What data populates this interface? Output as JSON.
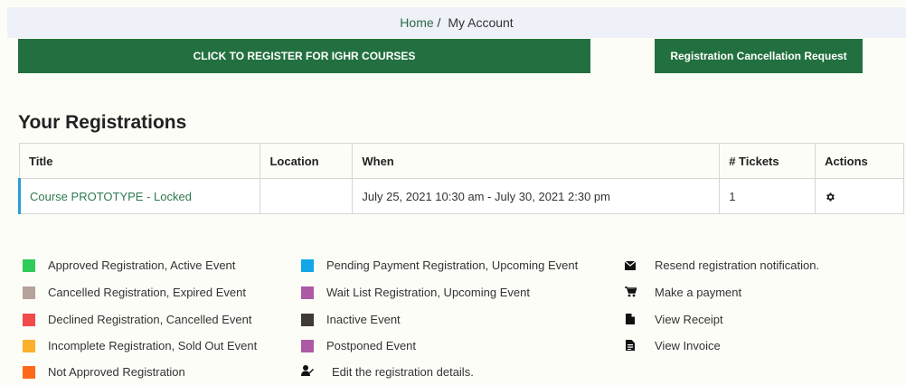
{
  "breadcrumb": {
    "home": "Home",
    "separator": "/",
    "current": "My Account"
  },
  "buttons": {
    "register": "CLICK TO REGISTER FOR IGHR COURSES",
    "cancellation": "Registration Cancellation Request"
  },
  "heading": "Your Registrations",
  "table": {
    "headers": [
      "Title",
      "Location",
      "When",
      "# Tickets",
      "Actions"
    ],
    "rows": [
      {
        "title": "Course PROTOTYPE - Locked",
        "location": "",
        "when": "July 25, 2021 10:30 am - July 30, 2021 2:30 pm",
        "tickets": "1",
        "action_icon": "gear-icon"
      }
    ]
  },
  "legend": {
    "col1": [
      {
        "label": "Approved Registration, Active Event",
        "color": "#2ecc5a"
      },
      {
        "label": "Cancelled Registration, Expired Event",
        "color": "#b5a49c"
      },
      {
        "label": "Declined Registration, Cancelled Event",
        "color": "#f24a4a"
      },
      {
        "label": "Incomplete Registration, Sold Out Event",
        "color": "#fbb12b"
      },
      {
        "label": "Not Approved Registration",
        "color": "#ff6a1a"
      }
    ],
    "col2": [
      {
        "label": "Pending Payment Registration, Upcoming Event",
        "color": "#13a7e8"
      },
      {
        "label": "Wait List Registration, Upcoming Event",
        "color": "#ad5aa5"
      },
      {
        "label": "Inactive Event",
        "color": "#3f3a38"
      },
      {
        "label": "Postponed Event",
        "color": "#ad5aa5"
      },
      {
        "label": "Edit the registration details.",
        "icon": "edit-user-icon"
      }
    ],
    "col3": [
      {
        "label": "Resend registration notification.",
        "icon": "envelope-icon"
      },
      {
        "label": "Make a payment",
        "icon": "cart-icon"
      },
      {
        "label": "View Receipt",
        "icon": "receipt-icon"
      },
      {
        "label": "View Invoice",
        "icon": "invoice-icon"
      }
    ]
  }
}
